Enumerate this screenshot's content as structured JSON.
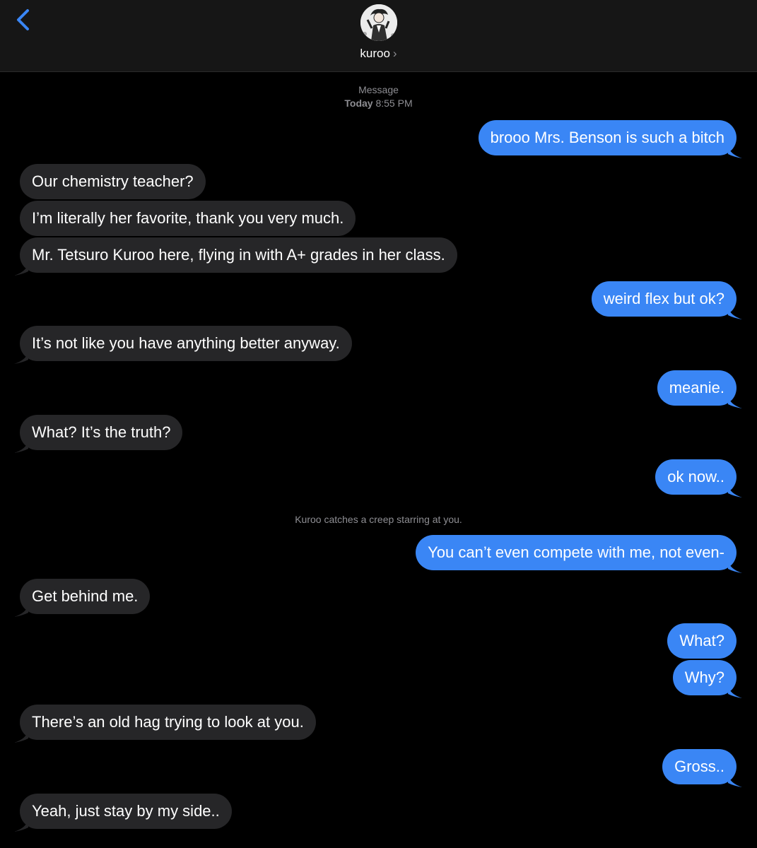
{
  "header": {
    "contact_name": "kuroo",
    "chevron": "›",
    "back_icon": "chevron-left-icon",
    "accent_color": "#3a86f5"
  },
  "conversation_meta": {
    "service": "Message",
    "day": "Today",
    "time": "8:55 PM"
  },
  "messages": [
    {
      "from": "me",
      "text": "brooo Mrs. Benson is such a bitch"
    },
    {
      "from": "them",
      "text": "Our chemistry teacher?"
    },
    {
      "from": "them",
      "text": "I’m literally her favorite, thank you very much."
    },
    {
      "from": "them",
      "text": "Mr. Tetsuro Kuroo here, flying in with A+ grades in her class."
    },
    {
      "from": "me",
      "text": "weird flex but ok?"
    },
    {
      "from": "them",
      "text": "It’s not like you have anything better anyway."
    },
    {
      "from": "me",
      "text": "meanie."
    },
    {
      "from": "them",
      "text": "What? It’s the truth?"
    },
    {
      "from": "me",
      "text": "ok now.."
    },
    {
      "from": "me",
      "text": "You can’t even compete with me, not even-"
    },
    {
      "from": "them",
      "text": "Get behind me."
    },
    {
      "from": "me",
      "text": "What?"
    },
    {
      "from": "me",
      "text": "Why?"
    },
    {
      "from": "them",
      "text": "There’s an old hag trying to look at you."
    },
    {
      "from": "me",
      "text": "Gross.."
    },
    {
      "from": "them",
      "text": "Yeah, just stay by my side.."
    }
  ],
  "narration": "Kuroo catches a creep starring at you.",
  "colors": {
    "outgoing_bubble": "#3a86f5",
    "incoming_bubble": "#262628",
    "background": "#000000",
    "header": "#161616"
  }
}
